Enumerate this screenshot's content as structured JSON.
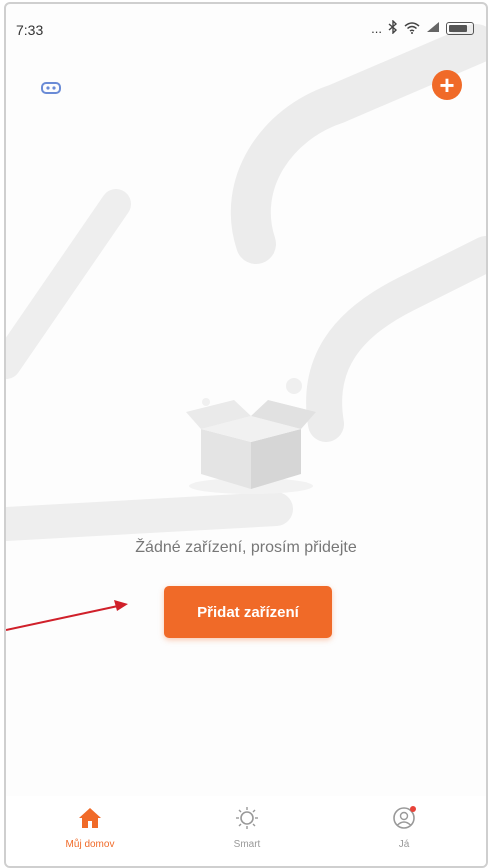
{
  "status_bar": {
    "time": "7:33",
    "indicator": "..."
  },
  "header": {
    "home_icon": "home-select-icon",
    "add_icon": "plus-icon"
  },
  "empty_state": {
    "message": "Žádné zařízení, prosím přidejte",
    "button_label": "Přidat zařízení"
  },
  "tabs": [
    {
      "label": "Můj domov",
      "icon": "home-icon",
      "active": true
    },
    {
      "label": "Smart",
      "icon": "sun-icon",
      "active": false
    },
    {
      "label": "Já",
      "icon": "profile-icon",
      "active": false
    }
  ],
  "colors": {
    "accent": "#f06a28",
    "annotation_arrow": "#d0202a"
  }
}
